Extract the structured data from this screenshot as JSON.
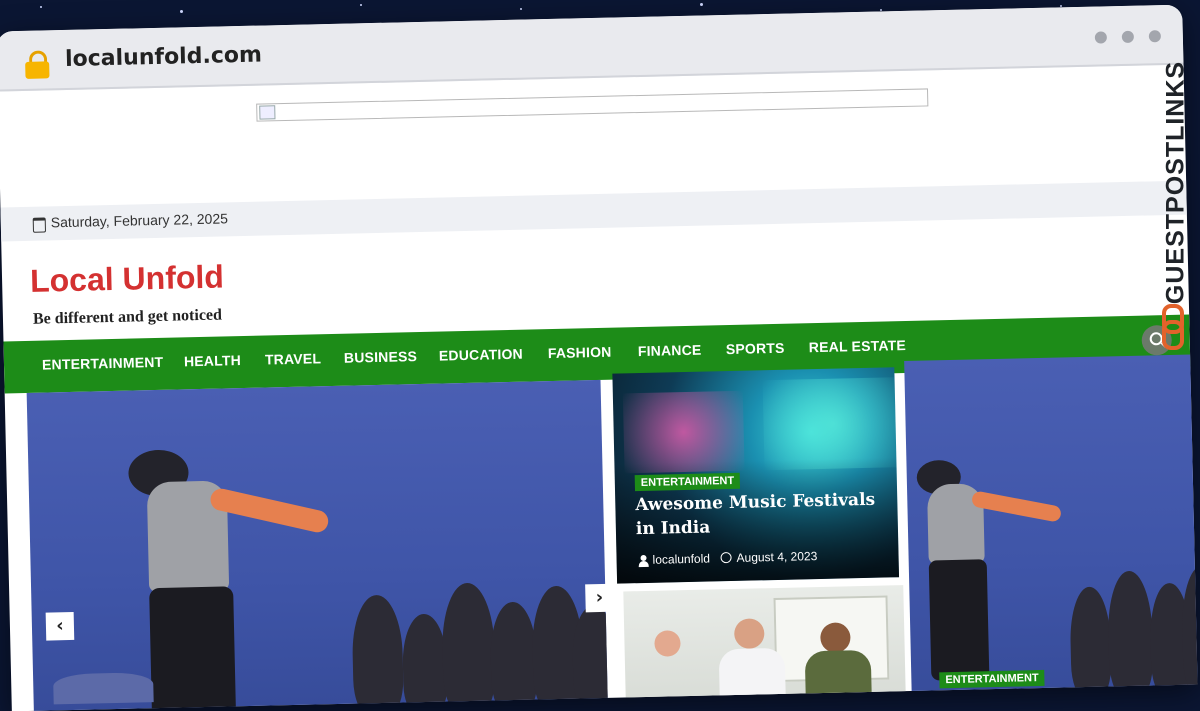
{
  "browser": {
    "url": "localunfold.com"
  },
  "topbar": {
    "date": "Saturday, February 22, 2025"
  },
  "site": {
    "title": "Local Unfold",
    "tagline": "Be different and get noticed"
  },
  "nav": {
    "items": [
      "ENTERTAINMENT",
      "HEALTH",
      "TRAVEL",
      "BUSINESS",
      "EDUCATION",
      "FASHION",
      "FINANCE",
      "SPORTS",
      "REAL ESTATE"
    ]
  },
  "slider": {
    "prev": "‹",
    "next": "›",
    "right_tag": "ENTERTAINMENT"
  },
  "featured": {
    "tag": "ENTERTAINMENT",
    "title": "Awesome Music Festivals in India",
    "author": "localunfold",
    "date": "August 4, 2023"
  },
  "watermark": {
    "text": "GUESTPOSTLINKS"
  },
  "colors": {
    "brand_red": "#d43131",
    "nav_green": "#1d8c18"
  },
  "icons": {
    "lock": "lock-icon",
    "calendar": "calendar-icon",
    "search": "search-icon",
    "user": "user-icon",
    "clock": "clock-icon",
    "link": "link-icon"
  }
}
